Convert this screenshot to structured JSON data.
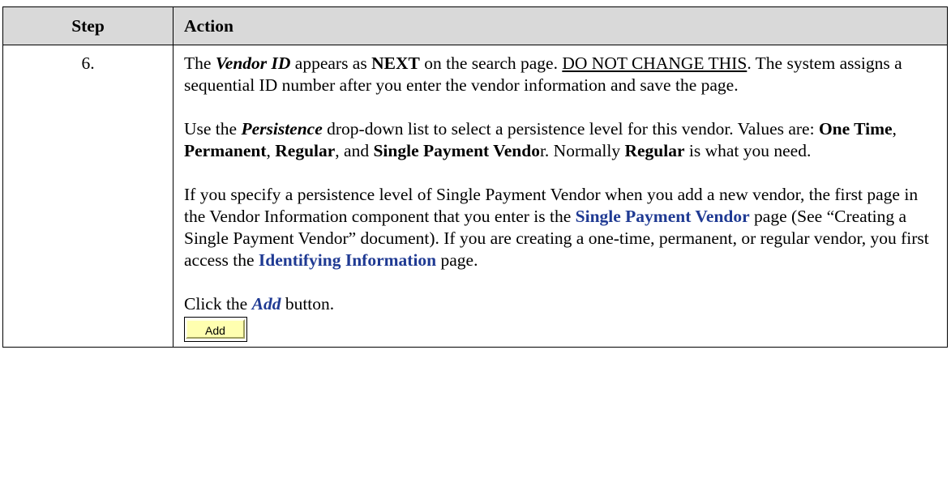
{
  "header": {
    "step_label": "Step",
    "action_label": "Action"
  },
  "row": {
    "step_number": "6.",
    "para1": {
      "t1": "The ",
      "vendor_id": "Vendor ID",
      "t2": " appears as ",
      "next": "NEXT",
      "t3": " on the search page. ",
      "do_not_change": "DO NOT CHANGE THIS",
      "t4": ". The system assigns a sequential ID number after you enter the vendor information and save the page."
    },
    "para2": {
      "t1": "Use the ",
      "persistence": "Persistence",
      "t2": " drop-down list to select a persistence level for this vendor. Values are: ",
      "one_time": "One Time",
      "t3": ", ",
      "permanent": "Permanent",
      "t4": ", ",
      "regular": "Regular",
      "t5": ", and ",
      "single_payment_vendo": "Single Payment Vendo",
      "t6": "r. Normally ",
      "regular2": "Regular",
      "t7": " is what you need."
    },
    "para3": {
      "t1": "If you specify a persistence level of Single Payment Vendor when you add a new vendor, the first page in the Vendor Information component that you enter is the ",
      "single_payment_link": "Single Payment Vendor",
      "t2": " page (See “Creating a Single Payment Vendor” document). If you are creating a one-time, permanent, or regular vendor, you first access the ",
      "identifying_link": "Identifying Information",
      "t3": " page."
    },
    "para4": {
      "t1": "Click the ",
      "add_word": "Add",
      "t2": " button."
    },
    "add_button_label": "Add"
  }
}
